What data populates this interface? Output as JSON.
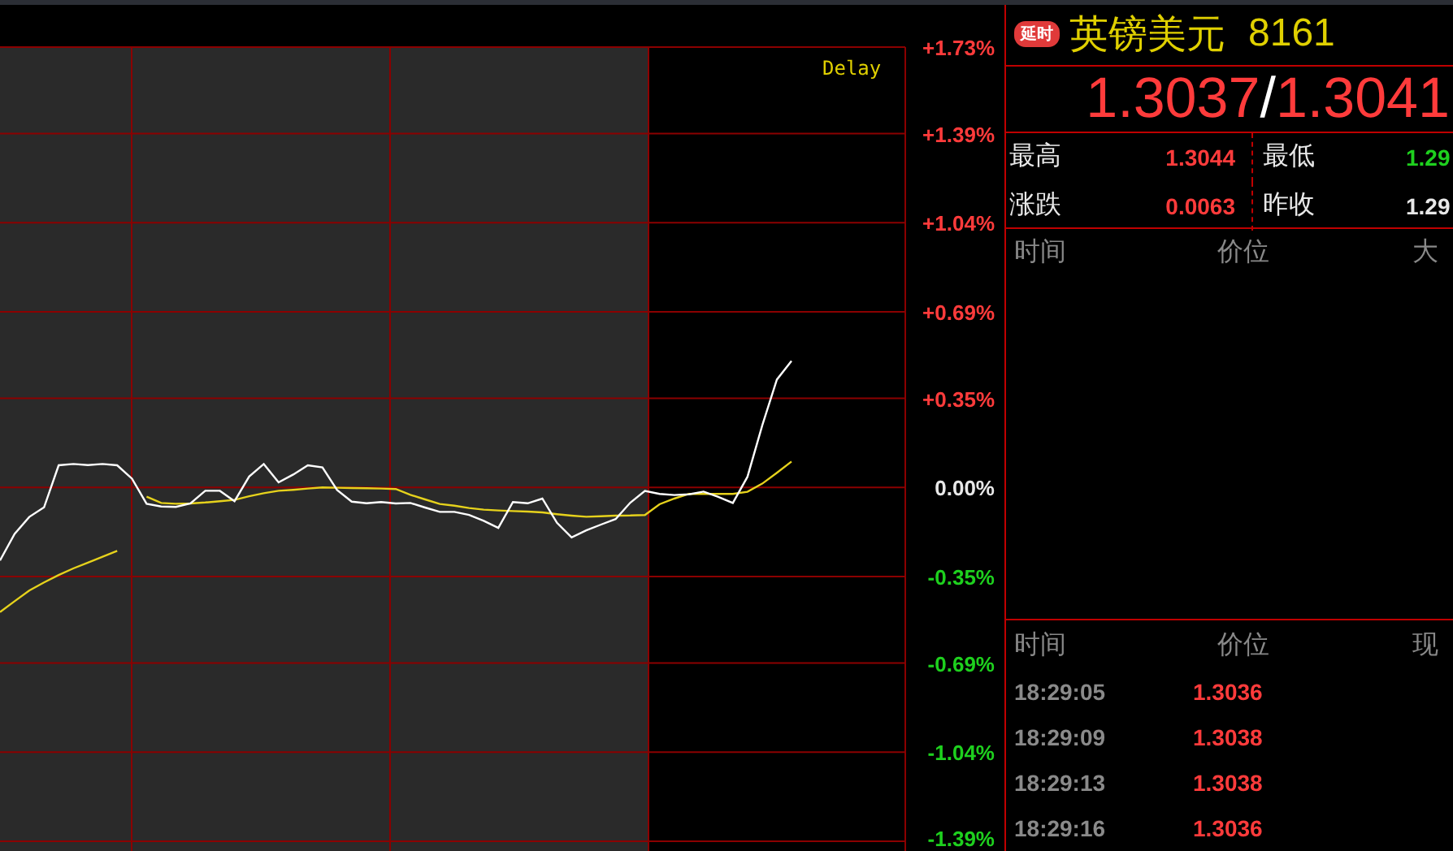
{
  "chart": {
    "chart_data": {
      "type": "line",
      "ylim": [
        -1.39,
        1.73
      ],
      "yticks": [
        {
          "value": 1.73,
          "label": "+1.73%"
        },
        {
          "value": 1.39,
          "label": "+1.39%"
        },
        {
          "value": 1.04,
          "label": "+1.04%"
        },
        {
          "value": 0.69,
          "label": "+0.69%"
        },
        {
          "value": 0.35,
          "label": "+0.35%"
        },
        {
          "value": 0,
          "label": "0.00%"
        },
        {
          "value": -0.35,
          "label": "-0.35%"
        },
        {
          "value": -0.69,
          "label": "-0.69%"
        },
        {
          "value": -1.04,
          "label": "-1.04%"
        },
        {
          "value": -1.39,
          "label": "-1.39%"
        }
      ],
      "grid": true,
      "series": [
        {
          "color": "#ffffff",
          "values": [
            -0.287,
            -0.182,
            -0.116,
            -0.078,
            0.087,
            0.092,
            0.088,
            0.092,
            0.087,
            0.035,
            -0.064,
            -0.075,
            -0.076,
            -0.063,
            -0.013,
            -0.013,
            -0.054,
            0.043,
            0.092,
            0.02,
            0.051,
            0.087,
            0.079,
            -0.01,
            -0.056,
            -0.062,
            -0.057,
            -0.063,
            -0.061,
            -0.079,
            -0.096,
            -0.096,
            -0.108,
            -0.131,
            -0.159,
            -0.057,
            -0.062,
            -0.044,
            -0.139,
            -0.196,
            -0.169,
            -0.146,
            -0.124,
            -0.06,
            -0.014,
            -0.025,
            -0.03,
            -0.027,
            -0.016,
            -0.037,
            -0.061,
            0.042,
            0.244,
            0.424,
            0.497
          ]
        },
        {
          "color": "#e6d21c",
          "values": [
            -0.49,
            -0.447,
            -0.405,
            -0.373,
            -0.344,
            -0.318,
            -0.295,
            -0.272,
            -0.249,
            null,
            -0.036,
            -0.061,
            -0.064,
            -0.063,
            -0.059,
            -0.054,
            -0.049,
            -0.035,
            -0.023,
            -0.013,
            -0.009,
            -0.004,
            0,
            -0.001,
            -0.002,
            -0.003,
            -0.004,
            -0.006,
            -0.029,
            -0.047,
            -0.065,
            -0.072,
            -0.081,
            -0.087,
            -0.09,
            -0.093,
            -0.095,
            -0.098,
            -0.105,
            -0.111,
            -0.115,
            -0.113,
            -0.111,
            -0.11,
            -0.108,
            -0.066,
            -0.044,
            -0.025,
            -0.025,
            -0.025,
            -0.025,
            -0.017,
            0.015,
            0.058,
            0.102
          ]
        }
      ]
    },
    "delay_mark": "Delay"
  },
  "quote": {
    "badge": "延时",
    "name": "英镑美元",
    "code": "8161",
    "bid": "1.3037",
    "separator": "/",
    "ask": "1.3041",
    "stats": [
      {
        "label": "最高",
        "value": "1.3044",
        "kind": "up"
      },
      {
        "label": "最低",
        "value": "1.29",
        "kind": "down"
      },
      {
        "label": "涨跌",
        "value": "0.0063",
        "kind": "up"
      },
      {
        "label": "昨收",
        "value": "1.29",
        "kind": "flat"
      }
    ]
  },
  "big_orders": {
    "columns": [
      "时间",
      "价位",
      "大"
    ]
  },
  "ticks": {
    "columns": [
      "时间",
      "价位",
      "现"
    ],
    "rows": [
      {
        "time": "18:29:05",
        "price": "1.3036"
      },
      {
        "time": "18:29:09",
        "price": "1.3038"
      },
      {
        "time": "18:29:13",
        "price": "1.3038"
      },
      {
        "time": "18:29:16",
        "price": "1.3036"
      }
    ]
  }
}
